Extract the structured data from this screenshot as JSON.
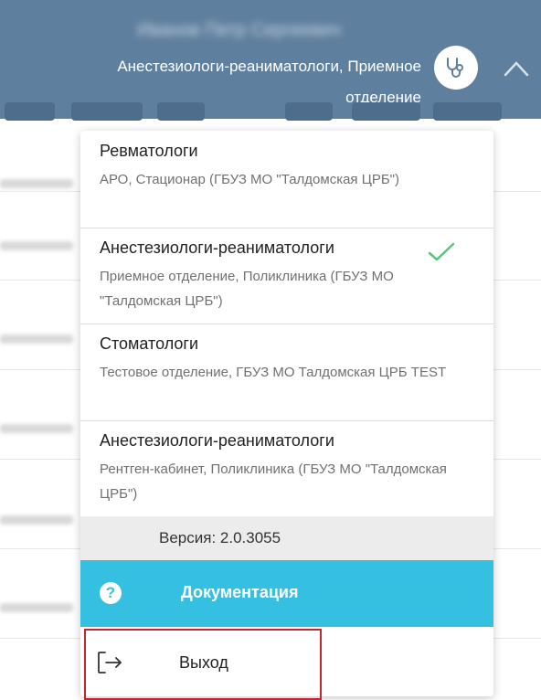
{
  "header": {
    "user_name": "Иванов Петр Сергеевич",
    "role": "Анестезиологи-реаниматологи, Приемное",
    "department": "отделение",
    "role_icon": "stethoscope-icon",
    "toggle_icon": "chevron-up-icon"
  },
  "menu": {
    "items": [
      {
        "title": "Ревматологи",
        "subtitle": "АРО, Стационар (ГБУЗ МО \"Талдомская ЦРБ\")",
        "selected": false
      },
      {
        "title": "Анестезиологи-реаниматологи",
        "subtitle": "Приемное отделение, Поликлиника (ГБУЗ МО \"Талдомская ЦРБ\")",
        "selected": true
      },
      {
        "title": "Стоматологи",
        "subtitle": "Тестовое отделение, ГБУЗ МО Талдомская ЦРБ TEST",
        "selected": false
      },
      {
        "title": "Анестезиологи-реаниматологи",
        "subtitle": "Рентген-кабинет, Поликлиника (ГБУЗ МО \"Талдомская ЦРБ\")",
        "selected": false
      }
    ],
    "version": "Версия: 2.0.3055",
    "documentation_label": "Документация",
    "documentation_icon": "?",
    "logout_label": "Выход"
  },
  "colors": {
    "header_bg": "#5f7f9e",
    "accent": "#35bfe0",
    "check": "#5cc47a",
    "highlight_border": "#c0262d"
  }
}
